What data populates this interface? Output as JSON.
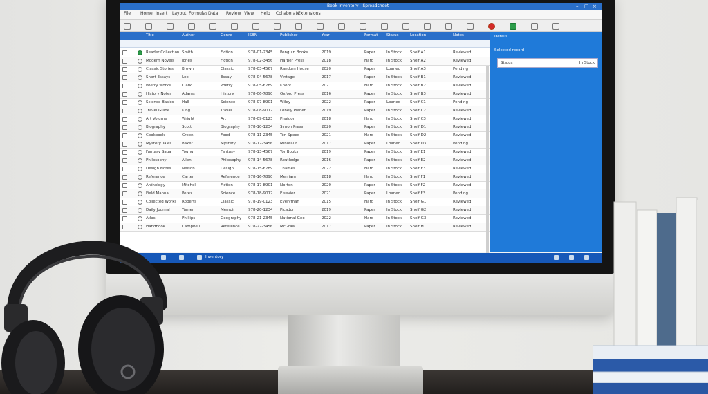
{
  "window": {
    "title": "Book Inventory - Spreadsheet",
    "controls": [
      "–",
      "□",
      "×"
    ]
  },
  "menu": [
    "File",
    "Home",
    "Insert",
    "Layout",
    "Formulas",
    "Data",
    "Review",
    "View",
    "Help",
    "Collaborate",
    "Extensions"
  ],
  "toolbar_icons": [
    "new-icon",
    "open-icon",
    "save-icon",
    "undo-icon",
    "redo-icon",
    "copy-icon",
    "paste-icon",
    "cut-icon",
    "print-icon",
    "bold-icon",
    "italic-icon",
    "underline-icon",
    "align-icon",
    "filter-icon",
    "sort-icon",
    "search-icon",
    "chart-icon",
    "record-icon",
    "green-sheet-icon",
    "settings-icon",
    "close-icon"
  ],
  "grid": {
    "headers": [
      "Title",
      "Author",
      "Genre",
      "ISBN",
      "Publisher",
      "Year",
      "Format",
      "Status",
      "Location",
      "Notes"
    ],
    "rows": [
      [
        "Reader Collection",
        "Smith",
        "Fiction",
        "978-01-2345",
        "Penguin Books",
        "2019",
        "Paper",
        "In Stock",
        "Shelf A1",
        "Reviewed"
      ],
      [
        "Modern Novels",
        "Jones",
        "Fiction",
        "978-02-3456",
        "Harper Press",
        "2018",
        "Hard",
        "In Stock",
        "Shelf A2",
        "Reviewed"
      ],
      [
        "Classic Stories",
        "Brown",
        "Classic",
        "978-03-4567",
        "Random House",
        "2020",
        "Paper",
        "Loaned",
        "Shelf A3",
        "Pending"
      ],
      [
        "Short Essays",
        "Lee",
        "Essay",
        "978-04-5678",
        "Vintage",
        "2017",
        "Paper",
        "In Stock",
        "Shelf B1",
        "Reviewed"
      ],
      [
        "Poetry Works",
        "Clark",
        "Poetry",
        "978-05-6789",
        "Knopf",
        "2021",
        "Hard",
        "In Stock",
        "Shelf B2",
        "Reviewed"
      ],
      [
        "History Notes",
        "Adams",
        "History",
        "978-06-7890",
        "Oxford Press",
        "2016",
        "Paper",
        "In Stock",
        "Shelf B3",
        "Reviewed"
      ],
      [
        "Science Basics",
        "Hall",
        "Science",
        "978-07-8901",
        "Wiley",
        "2022",
        "Paper",
        "Loaned",
        "Shelf C1",
        "Pending"
      ],
      [
        "Travel Guide",
        "King",
        "Travel",
        "978-08-9012",
        "Lonely Planet",
        "2019",
        "Paper",
        "In Stock",
        "Shelf C2",
        "Reviewed"
      ],
      [
        "Art Volume",
        "Wright",
        "Art",
        "978-09-0123",
        "Phaidon",
        "2018",
        "Hard",
        "In Stock",
        "Shelf C3",
        "Reviewed"
      ],
      [
        "Biography",
        "Scott",
        "Biography",
        "978-10-1234",
        "Simon Press",
        "2020",
        "Paper",
        "In Stock",
        "Shelf D1",
        "Reviewed"
      ],
      [
        "Cookbook",
        "Green",
        "Food",
        "978-11-2345",
        "Ten Speed",
        "2021",
        "Hard",
        "In Stock",
        "Shelf D2",
        "Reviewed"
      ],
      [
        "Mystery Tales",
        "Baker",
        "Mystery",
        "978-12-3456",
        "Minotaur",
        "2017",
        "Paper",
        "Loaned",
        "Shelf D3",
        "Pending"
      ],
      [
        "Fantasy Saga",
        "Young",
        "Fantasy",
        "978-13-4567",
        "Tor Books",
        "2019",
        "Paper",
        "In Stock",
        "Shelf E1",
        "Reviewed"
      ],
      [
        "Philosophy",
        "Allen",
        "Philosophy",
        "978-14-5678",
        "Routledge",
        "2016",
        "Paper",
        "In Stock",
        "Shelf E2",
        "Reviewed"
      ],
      [
        "Design Notes",
        "Nelson",
        "Design",
        "978-15-6789",
        "Thames",
        "2022",
        "Hard",
        "In Stock",
        "Shelf E3",
        "Reviewed"
      ],
      [
        "Reference",
        "Carter",
        "Reference",
        "978-16-7890",
        "Merriam",
        "2018",
        "Hard",
        "In Stock",
        "Shelf F1",
        "Reviewed"
      ],
      [
        "Anthology",
        "Mitchell",
        "Fiction",
        "978-17-8901",
        "Norton",
        "2020",
        "Paper",
        "In Stock",
        "Shelf F2",
        "Reviewed"
      ],
      [
        "Field Manual",
        "Perez",
        "Science",
        "978-18-9012",
        "Elsevier",
        "2021",
        "Paper",
        "Loaned",
        "Shelf F3",
        "Pending"
      ],
      [
        "Collected Works",
        "Roberts",
        "Classic",
        "978-19-0123",
        "Everyman",
        "2015",
        "Hard",
        "In Stock",
        "Shelf G1",
        "Reviewed"
      ],
      [
        "Daily Journal",
        "Turner",
        "Memoir",
        "978-20-1234",
        "Picador",
        "2019",
        "Paper",
        "In Stock",
        "Shelf G2",
        "Reviewed"
      ],
      [
        "Atlas",
        "Phillips",
        "Geography",
        "978-21-2345",
        "National Geo",
        "2022",
        "Hard",
        "In Stock",
        "Shelf G3",
        "Reviewed"
      ],
      [
        "Handbook",
        "Campbell",
        "Reference",
        "978-22-3456",
        "McGraw",
        "2017",
        "Paper",
        "In Stock",
        "Shelf H1",
        "Reviewed"
      ]
    ]
  },
  "panel": {
    "title": "Details",
    "subtitle": "Selected record",
    "field_label": "Status",
    "field_value": "In Stock"
  },
  "taskbar": {
    "label": "Inventory"
  },
  "colors": {
    "accent": "#2a6fc9",
    "panel": "#1f7ad9",
    "taskbar": "#1658b8"
  }
}
